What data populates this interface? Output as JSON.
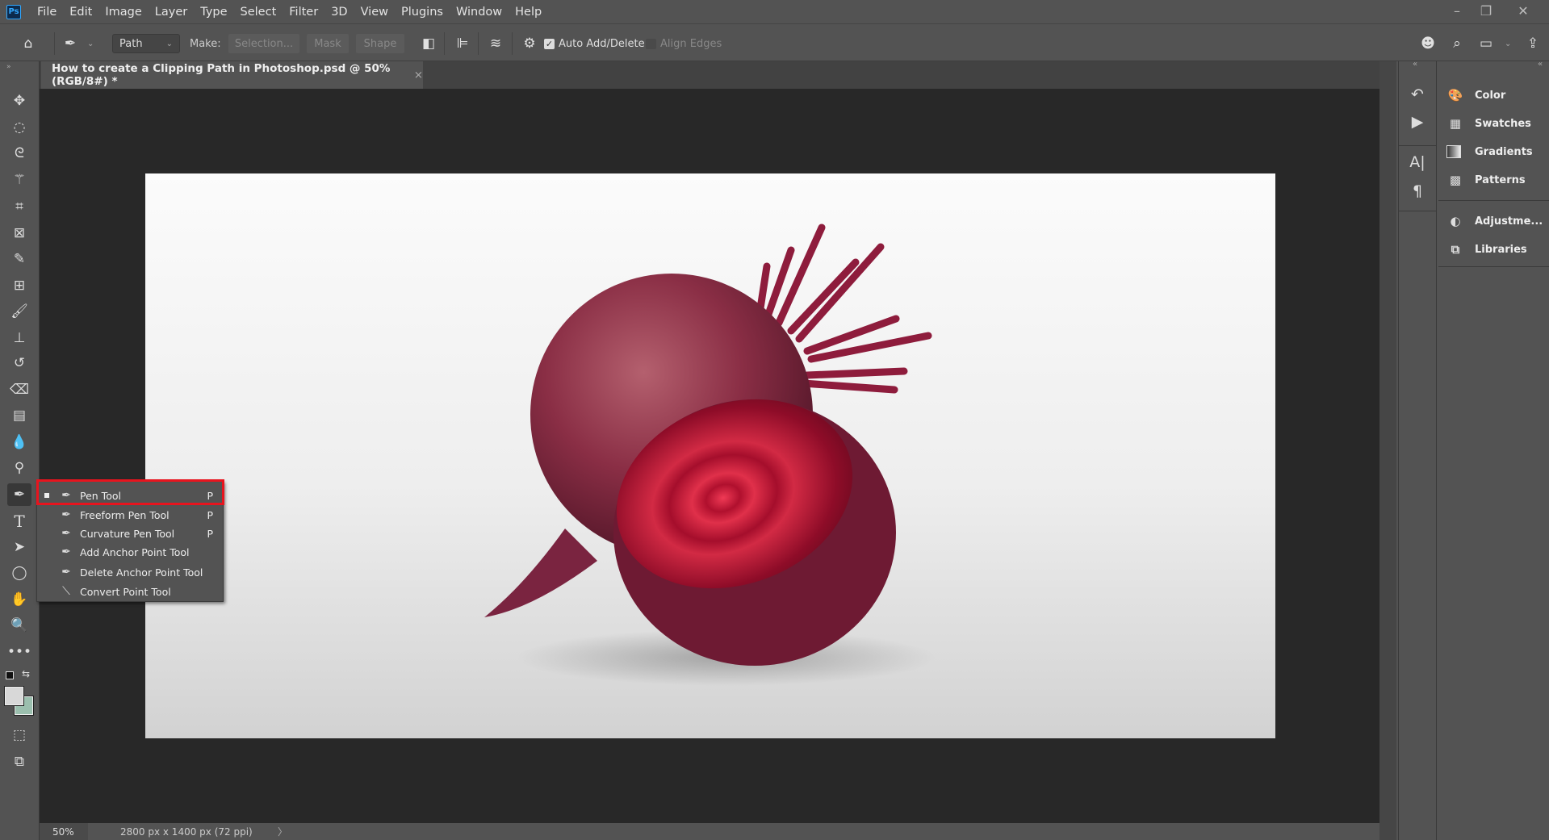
{
  "app": {
    "logo": "Ps"
  },
  "menu": [
    "File",
    "Edit",
    "Image",
    "Layer",
    "Type",
    "Select",
    "Filter",
    "3D",
    "View",
    "Plugins",
    "Window",
    "Help"
  ],
  "window_controls": {
    "minimize": "–",
    "restore": "❐",
    "close": "✕"
  },
  "options": {
    "mode_select": "Path",
    "make_label": "Make:",
    "selection_button": "Selection...",
    "mask_button": "Mask",
    "shape_button": "Shape",
    "auto_add_delete": {
      "label": "Auto Add/Delete",
      "checked": true
    },
    "align_edges": {
      "label": "Align Edges",
      "checked": false
    }
  },
  "document_tab": {
    "title": "How to create a Clipping Path in Photoshop.psd @ 50% (RGB/8#) *",
    "close": "×"
  },
  "tools": [
    "move",
    "lasso-elliptical",
    "polygonal-lasso",
    "magic-wand",
    "crop",
    "frame",
    "eyedropper",
    "spot-healing",
    "brush",
    "clone-stamp",
    "history-brush",
    "eraser",
    "gradient",
    "blur",
    "dodge",
    "pen",
    "type",
    "path-selection",
    "ellipse",
    "hand",
    "zoom",
    "more"
  ],
  "colors": {
    "foreground": "#d8d8d8",
    "background": "#9bbfae",
    "highlight": "#e8141e",
    "canvas_bg": "#282828"
  },
  "flyout": {
    "items": [
      {
        "label": "Pen Tool",
        "shortcut": "P",
        "selected": true,
        "icon": "pen-icon"
      },
      {
        "label": "Freeform Pen Tool",
        "shortcut": "P",
        "icon": "freeform-pen-icon"
      },
      {
        "label": "Curvature Pen Tool",
        "shortcut": "P",
        "icon": "curvature-pen-icon"
      },
      {
        "label": "Add Anchor Point Tool",
        "shortcut": "",
        "icon": "add-anchor-icon"
      },
      {
        "label": "Delete Anchor Point Tool",
        "shortcut": "",
        "icon": "delete-anchor-icon"
      },
      {
        "label": "Convert Point Tool",
        "shortcut": "",
        "icon": "convert-point-icon"
      }
    ]
  },
  "panels": {
    "items": [
      {
        "label": "Color",
        "icon": "palette-icon"
      },
      {
        "label": "Swatches",
        "icon": "swatches-icon"
      },
      {
        "label": "Gradients",
        "icon": "gradient-icon"
      },
      {
        "label": "Patterns",
        "icon": "patterns-icon"
      },
      {
        "label": "Adjustme...",
        "icon": "adjustments-icon"
      },
      {
        "label": "Libraries",
        "icon": "libraries-icon"
      }
    ]
  },
  "status": {
    "zoom": "50%",
    "doc_info": "2800 px x 1400 px (72 ppi)",
    "arrow": "〉"
  }
}
